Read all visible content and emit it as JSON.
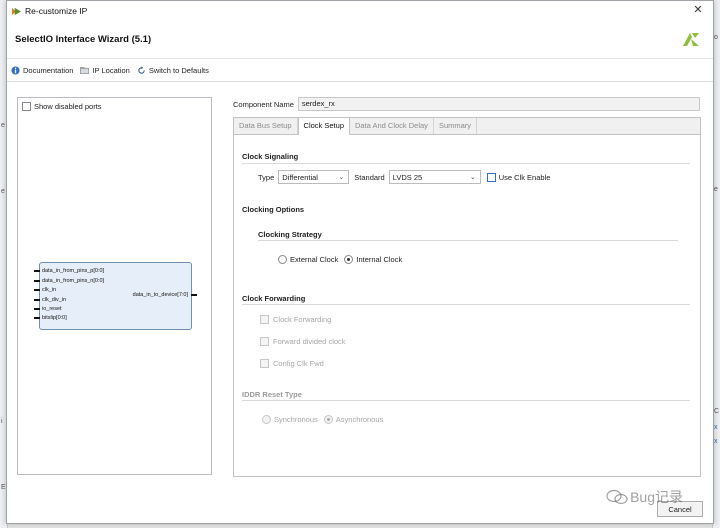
{
  "window": {
    "title": "Re-customize IP",
    "wizard_title": "SelectIO Interface Wizard (5.1)"
  },
  "toolbar": {
    "documentation": "Documentation",
    "ip_location": "IP Location",
    "switch_defaults": "Switch to Defaults"
  },
  "left_panel": {
    "show_disabled_ports": "Show disabled ports",
    "inputs": [
      "data_in_from_pins_p[0:0]",
      "data_in_from_pins_n[0:0]",
      "clk_in",
      "clk_div_in",
      "io_reset",
      "bitslip[0:0]"
    ],
    "output": "data_in_to_device[7:0]"
  },
  "component": {
    "label": "Component Name",
    "value": "serdex_rx"
  },
  "tabs": [
    "Data Bus Setup",
    "Clock Setup",
    "Data And Clock Delay",
    "Summary"
  ],
  "clock_signaling": {
    "heading": "Clock Signaling",
    "type_label": "Type",
    "type_value": "Differential",
    "standard_label": "Standard",
    "standard_value": "LVDS 25",
    "use_clk_enable": "Use Clk Enable"
  },
  "clocking_options": {
    "heading": "Clocking Options",
    "strategy_heading": "Clocking Strategy",
    "external": "External Clock",
    "internal": "Internal Clock",
    "selected": "Internal Clock"
  },
  "clock_forwarding": {
    "heading": "Clock Forwarding",
    "items": [
      "Clock Forwarding",
      "Forward divided clock",
      "Config Clk Fwd"
    ]
  },
  "iddr": {
    "heading": "IDDR Reset Type",
    "sync": "Synchronous",
    "async": "Asynchronous",
    "selected": "Asynchronous"
  },
  "footer": {
    "cancel": "Cancel",
    "watermark": "Bug记录"
  },
  "colors": {
    "accent": "#2f6fc4",
    "block_fill": "#e6eff9",
    "logo_green": "#8dbf3c"
  }
}
